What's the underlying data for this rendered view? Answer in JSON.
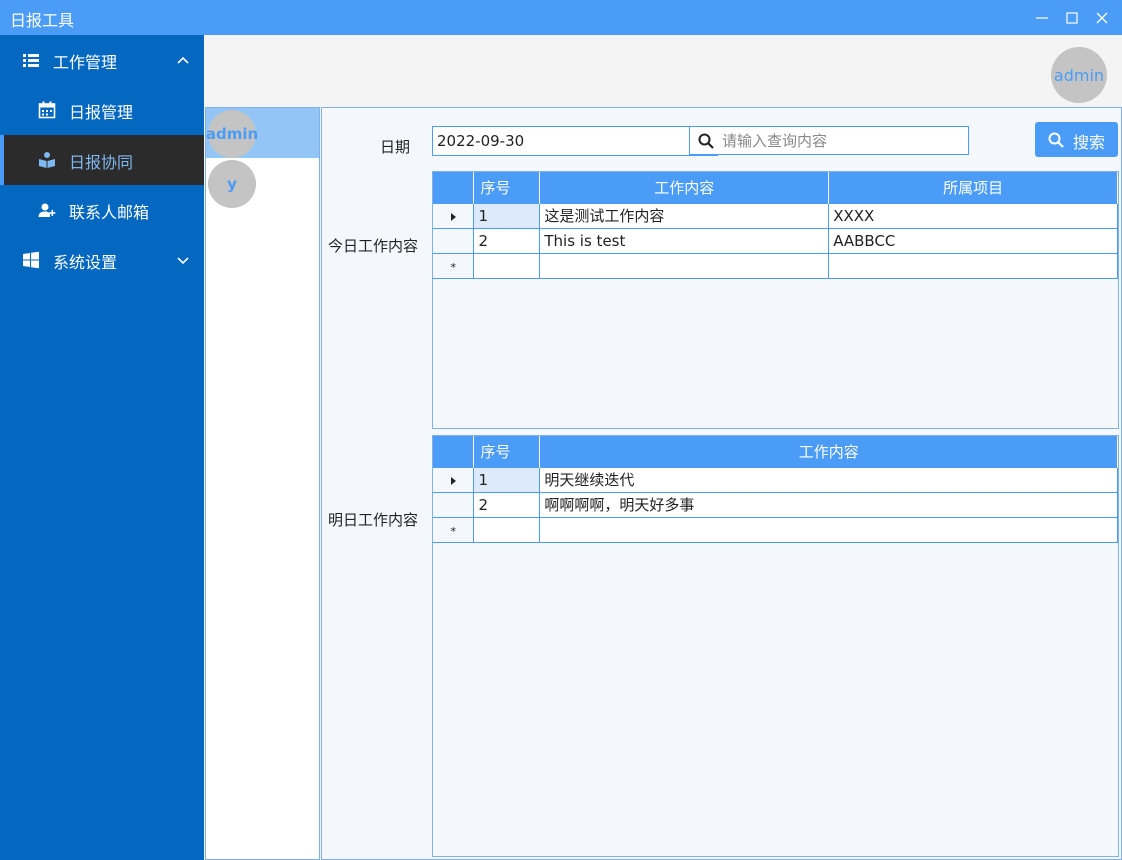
{
  "window": {
    "title": "日报工具"
  },
  "sidebar": {
    "items": [
      {
        "label": "工作管理",
        "icon": "list-icon",
        "expanded": true
      },
      {
        "label": "日报管理",
        "icon": "calendar-icon"
      },
      {
        "label": "日报协同",
        "icon": "reading-user-icon",
        "active": true
      },
      {
        "label": "联系人邮箱",
        "icon": "add-user-icon"
      },
      {
        "label": "系统设置",
        "icon": "windows-icon",
        "expanded": false
      }
    ]
  },
  "header": {
    "user_avatar": "admin"
  },
  "users": [
    {
      "name": "admin",
      "selected": true
    },
    {
      "name": "y",
      "selected": false
    }
  ],
  "form": {
    "date_label": "日期",
    "date_value": "2022-09-30",
    "search_placeholder": "请输入查询内容",
    "search_button": "搜索"
  },
  "today": {
    "label": "今日工作内容",
    "columns": [
      "序号",
      "工作内容",
      "所属项目"
    ],
    "rows": [
      {
        "seq": "1",
        "content": "这是测试工作内容",
        "project": "XXXX"
      },
      {
        "seq": "2",
        "content": "This is test",
        "project": "AABBCC"
      }
    ]
  },
  "tomorrow": {
    "label": "明日工作内容",
    "columns": [
      "序号",
      "工作内容"
    ],
    "rows": [
      {
        "seq": "1",
        "content": "明天继续迭代"
      },
      {
        "seq": "2",
        "content": "啊啊啊啊，明天好多事"
      }
    ]
  },
  "colors": {
    "accent": "#4a9cf7",
    "sidebar": "#0467c0",
    "active_nav": "#2b2b2b",
    "selected_user": "#93c5f7"
  }
}
